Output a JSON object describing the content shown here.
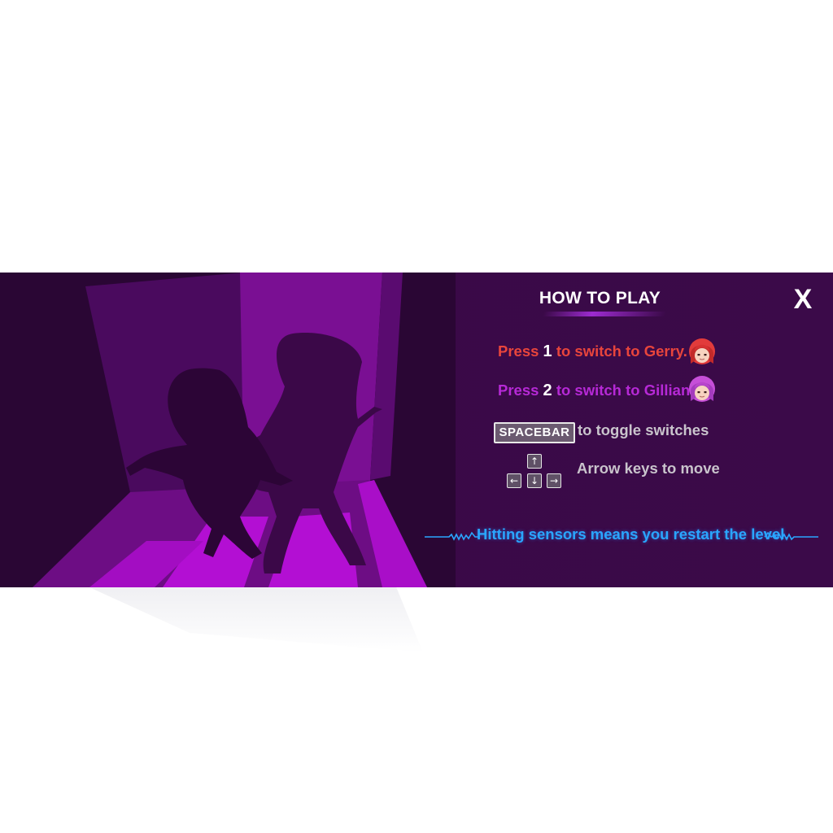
{
  "panel": {
    "title": "HOW TO PLAY",
    "close_label": "X"
  },
  "instructions": {
    "gerry": {
      "prefix": "Press",
      "key": "1",
      "suffix": "to switch to Gerry.",
      "color": "#e8453c"
    },
    "gillian": {
      "prefix": "Press",
      "key": "2",
      "suffix": "to switch to Gillian.",
      "color": "#b629d6"
    },
    "spacebar": {
      "key_label": "SPACEBAR",
      "text": "to toggle switches"
    },
    "arrows": {
      "text": "Arrow keys to move",
      "keys": [
        "↑",
        "←",
        "↓",
        "→"
      ]
    },
    "warning": {
      "text": "Hitting sensors means you restart the level.",
      "color": "#2aa6ff"
    }
  },
  "icons": {
    "gerry_avatar": "red-haired-girl-avatar-icon",
    "gillian_avatar": "pink-haired-girl-avatar-icon",
    "close": "close-icon"
  },
  "colors": {
    "panel_bg": "#3a0947",
    "accent_purple": "#9d2bd0"
  }
}
